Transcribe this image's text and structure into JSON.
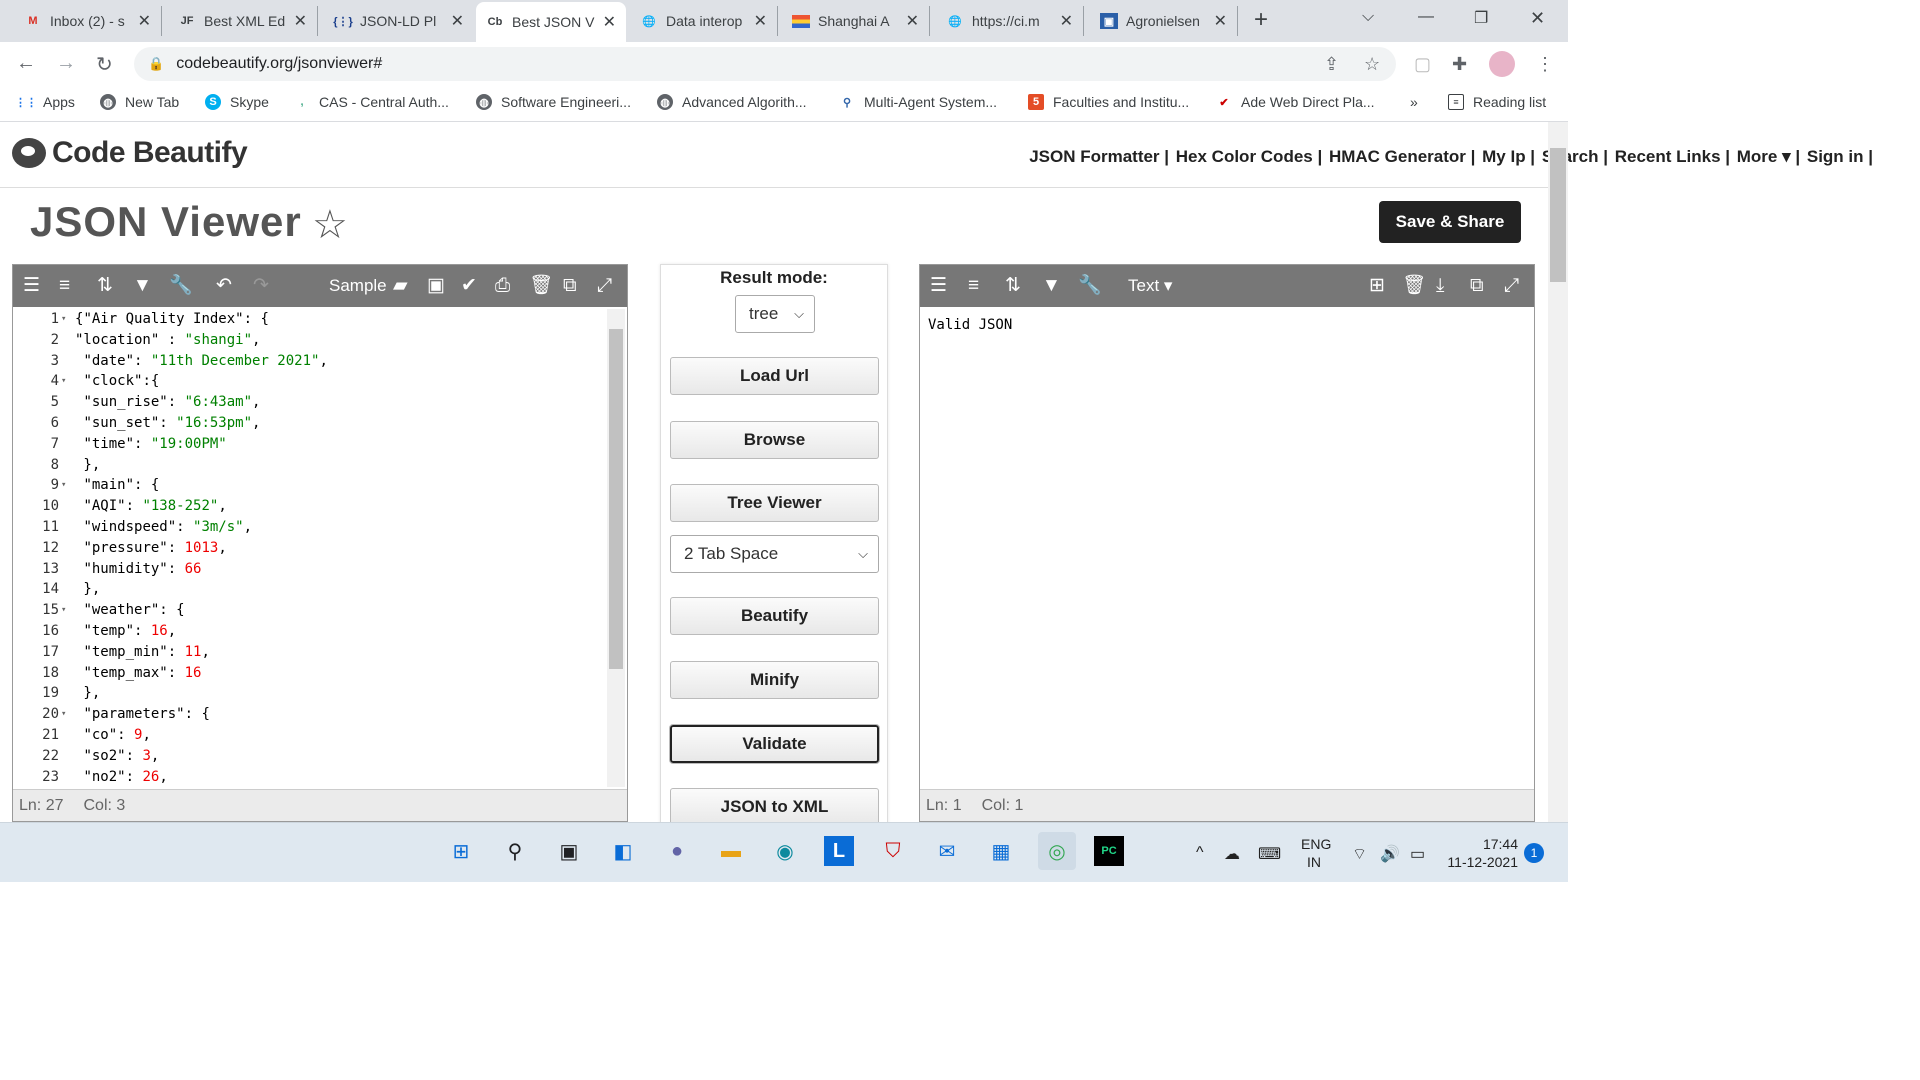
{
  "browser": {
    "tabs": [
      {
        "title": "Inbox (2) - s",
        "icon": "gmail-icon"
      },
      {
        "title": "Best XML Ed",
        "icon": "jf-icon"
      },
      {
        "title": "JSON-LD Pl",
        "icon": "jsonld-icon"
      },
      {
        "title": "Best JSON V",
        "icon": "cb-icon",
        "active": true
      },
      {
        "title": "Data interop",
        "icon": "globe-icon"
      },
      {
        "title": "Shanghai A",
        "icon": "flag-icon"
      },
      {
        "title": "https://ci.m",
        "icon": "globe-icon"
      },
      {
        "title": "Agronielsen",
        "icon": "image-icon"
      }
    ],
    "url": "codebeautify.org/jsonviewer#",
    "bookmarks": [
      {
        "label": "Apps",
        "icon": "apps-grid-icon"
      },
      {
        "label": "New Tab",
        "icon": "globe-icon"
      },
      {
        "label": "Skype",
        "icon": "skype-icon"
      },
      {
        "label": "CAS - Central Auth...",
        "icon": "cas-icon"
      },
      {
        "label": "Software Engineeri...",
        "icon": "globe-icon"
      },
      {
        "label": "Advanced Algorith...",
        "icon": "globe-icon"
      },
      {
        "label": "Multi-Agent System...",
        "icon": "agent-icon"
      },
      {
        "label": "Faculties and Institu...",
        "icon": "html5-icon"
      },
      {
        "label": "Ade Web Direct Pla...",
        "icon": "check-icon"
      }
    ],
    "more_bookmarks": "»",
    "reading_list": "Reading list"
  },
  "site": {
    "logo_text": "Code Beautify",
    "nav": [
      "JSON Formatter |",
      "Hex Color Codes |",
      "HMAC Generator |",
      "My Ip |",
      "Search |",
      "Recent Links |",
      "More ▾ |",
      "Sign in |"
    ],
    "page_title": "JSON Viewer",
    "save_share": "Save & Share"
  },
  "left_panel": {
    "sample_label": "Sample",
    "status_ln": "Ln: 27",
    "status_col": "Col: 3",
    "lines": [
      {
        "n": "1",
        "fold": true,
        "code": "{\"Air Quality Index\": {"
      },
      {
        "n": "2",
        "fold": false,
        "code": "\"location\" : \"shangi\","
      },
      {
        "n": "3",
        "fold": false,
        "code": " \"date\": \"11th December 2021\","
      },
      {
        "n": "4",
        "fold": true,
        "code": " \"clock\":{"
      },
      {
        "n": "5",
        "fold": false,
        "code": " \"sun_rise\": \"6:43am\","
      },
      {
        "n": "6",
        "fold": false,
        "code": " \"sun_set\": \"16:53pm\","
      },
      {
        "n": "7",
        "fold": false,
        "code": " \"time\": \"19:00PM\""
      },
      {
        "n": "8",
        "fold": false,
        "code": " },"
      },
      {
        "n": "9",
        "fold": true,
        "code": " \"main\": {"
      },
      {
        "n": "10",
        "fold": false,
        "code": " \"AQI\": \"138-252\","
      },
      {
        "n": "11",
        "fold": false,
        "code": " \"windspeed\": \"3m/s\","
      },
      {
        "n": "12",
        "fold": false,
        "code": " \"pressure\": 1013,"
      },
      {
        "n": "13",
        "fold": false,
        "code": " \"humidity\": 66"
      },
      {
        "n": "14",
        "fold": false,
        "code": " },"
      },
      {
        "n": "15",
        "fold": true,
        "code": " \"weather\": {"
      },
      {
        "n": "16",
        "fold": false,
        "code": " \"temp\": 16,"
      },
      {
        "n": "17",
        "fold": false,
        "code": " \"temp_min\": 11,"
      },
      {
        "n": "18",
        "fold": false,
        "code": " \"temp_max\": 16"
      },
      {
        "n": "19",
        "fold": false,
        "code": " },"
      },
      {
        "n": "20",
        "fold": true,
        "code": " \"parameters\": {"
      },
      {
        "n": "21",
        "fold": false,
        "code": " \"co\": 9,"
      },
      {
        "n": "22",
        "fold": false,
        "code": " \"so2\": 3,"
      },
      {
        "n": "23",
        "fold": false,
        "code": " \"no2\": 26,"
      }
    ]
  },
  "middle": {
    "result_mode_label": "Result mode:",
    "result_mode_value": "tree",
    "indent_value": "2 Tab Space",
    "buttons": [
      "Load Url",
      "Browse",
      "Tree Viewer",
      "Beautify",
      "Minify",
      "Validate",
      "JSON to XML"
    ]
  },
  "right_panel": {
    "mode_label": "Text ▾",
    "result": "Valid JSON",
    "status_ln": "Ln: 1",
    "status_col": "Col: 1"
  },
  "taskbar": {
    "lang_top": "ENG",
    "lang_bottom": "IN",
    "time": "17:44",
    "date": "11-12-2021",
    "notifications": "1"
  }
}
